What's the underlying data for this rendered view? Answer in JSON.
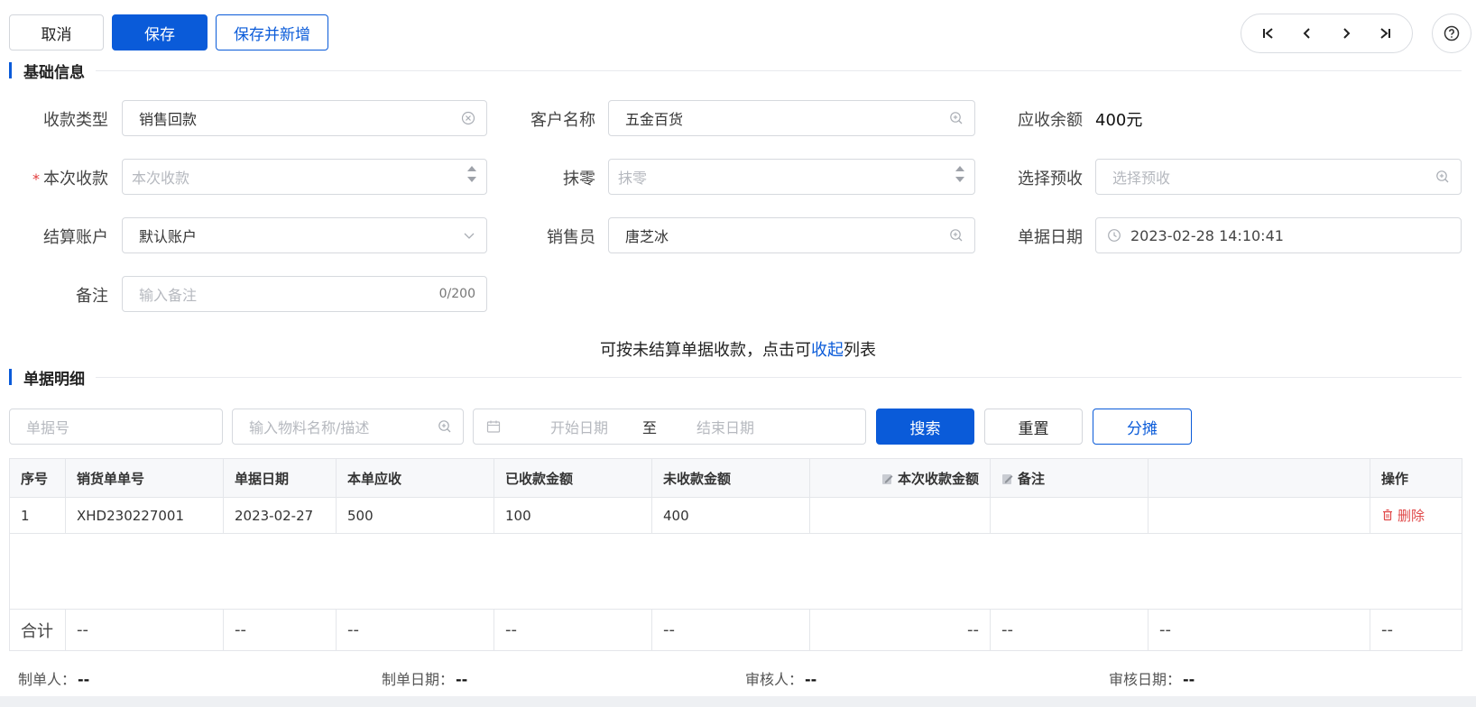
{
  "toolbar": {
    "cancel_label": "取消",
    "save_label": "保存",
    "save_new_label": "保存并新增"
  },
  "sections": {
    "basic": "基础信息",
    "detail": "单据明细"
  },
  "form": {
    "receipt_type": {
      "label": "收款类型",
      "value": "销售回款"
    },
    "customer": {
      "label": "客户名称",
      "value": "五金百货"
    },
    "receivable_balance": {
      "label": "应收余额",
      "value": "400元"
    },
    "current_amount": {
      "label": "本次收款",
      "required_mark": "*",
      "placeholder": "本次收款"
    },
    "rounding": {
      "label": "抹零",
      "placeholder": "抹零"
    },
    "prepayment": {
      "label": "选择预收",
      "placeholder": "选择预收"
    },
    "account": {
      "label": "结算账户",
      "value": "默认账户"
    },
    "salesperson": {
      "label": "销售员",
      "value": "唐芝冰"
    },
    "doc_date": {
      "label": "单据日期",
      "value": "2023-02-28 14:10:41"
    },
    "remark": {
      "label": "备注",
      "placeholder": "输入备注",
      "count": "0/200"
    }
  },
  "hint": {
    "prefix": "可按未结算单据收款，点击可",
    "link": "收起",
    "suffix": "列表"
  },
  "filters": {
    "doc_no_placeholder": "单据号",
    "material_placeholder": "输入物料名称/描述",
    "start_date_placeholder": "开始日期",
    "range_sep": "至",
    "end_date_placeholder": "结束日期",
    "search_label": "搜索",
    "reset_label": "重置",
    "allocate_label": "分摊"
  },
  "table": {
    "columns": [
      "序号",
      "销货单单号",
      "单据日期",
      "本单应收",
      "已收款金额",
      "未收款金额",
      "本次收款金额",
      "备注",
      "",
      "操作"
    ],
    "rows": [
      {
        "idx": "1",
        "order_no": "XHD230227001",
        "date": "2023-02-27",
        "receivable": "500",
        "received": "100",
        "unreceived": "400",
        "current": "",
        "remark": "",
        "extra": "",
        "action": "删除"
      }
    ],
    "totals": {
      "label": "合计",
      "placeholder": "--"
    }
  },
  "footer": {
    "creator_label": "制单人：",
    "creator_value": "--",
    "created_date_label": "制单日期：",
    "created_date_value": "--",
    "reviewer_label": "审核人：",
    "reviewer_value": "--",
    "review_date_label": "审核日期：",
    "review_date_value": "--"
  }
}
